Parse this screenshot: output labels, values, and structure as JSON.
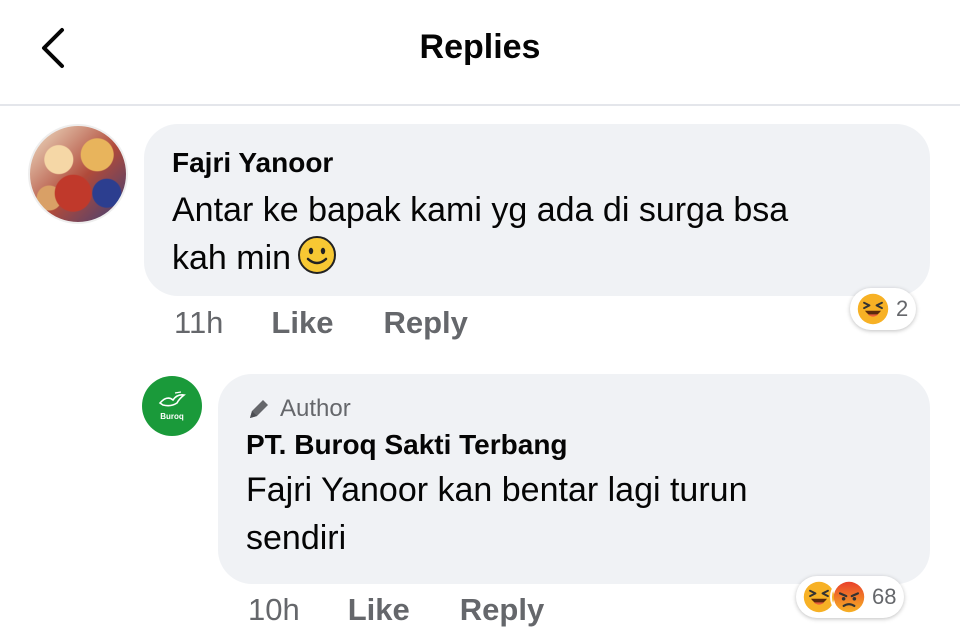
{
  "header": {
    "title": "Replies",
    "back_icon": "chevron-left-icon"
  },
  "comments": [
    {
      "author": "Fajri Yanoor",
      "text": "Antar ke bapak kami yg ada di surga bsa kah min",
      "text_line1": "Antar ke bapak kami yg ada di surga bsa",
      "text_line2": "kah min",
      "inline_emoji": "smiling-face-icon",
      "time": "11h",
      "like_label": "Like",
      "reply_label": "Reply",
      "reactions": [
        "laughing-face-icon"
      ],
      "reaction_count": "2"
    },
    {
      "badge": "Author",
      "badge_icon": "pencil-icon",
      "author": "PT. Buroq Sakti Terbang",
      "avatar_text": "Buroq",
      "text_line1": "Fajri Yanoor kan bentar lagi turun",
      "text_line2": "sendiri",
      "time": "10h",
      "like_label": "Like",
      "reply_label": "Reply",
      "reactions": [
        "laughing-face-icon",
        "angry-face-icon"
      ],
      "reaction_count": "68"
    }
  ],
  "colors": {
    "bubble": "#f0f2f5",
    "secondary_text": "#65676b",
    "page_avatar": "#1a9a3a",
    "reaction_yellow": "#f7b125",
    "reaction_angry": "#e9710f"
  }
}
